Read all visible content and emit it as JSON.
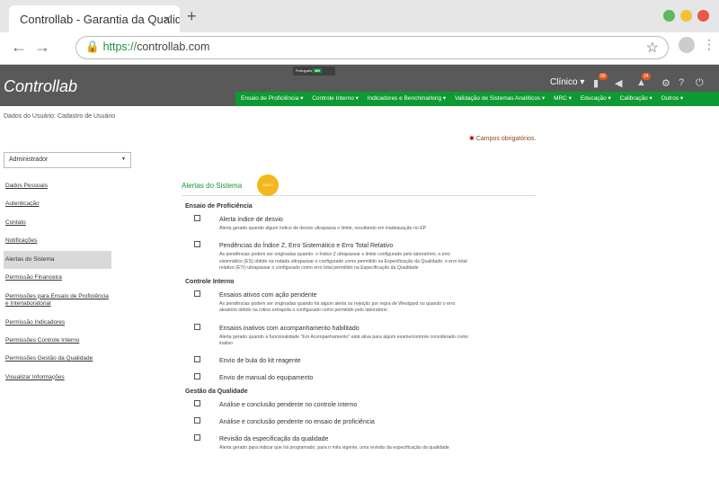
{
  "browser": {
    "tab_title": "Controllab - Garantia da Qualid",
    "tab_close": "×",
    "new_tab": "+",
    "url_proto": "https://",
    "url_host": "controllab.com",
    "dots": [
      "#5cb85c",
      "#f0c23a",
      "#e8564c"
    ]
  },
  "header": {
    "logo": "Controllab",
    "lang_label": "Português",
    "lang_code": "BR",
    "clinico": "Clínico",
    "badge_a": "99",
    "badge_b": "34"
  },
  "menu": [
    "Ensaio de Proficiência ▾",
    "Controle Interno ▾",
    "Indicadores e Benchmarking ▾",
    "Validação de Sistemas Analíticos ▾",
    "MRC ▾",
    "Educação ▾",
    "Calibração ▾",
    "Outros ▾"
  ],
  "breadcrumb": "Dados do Usuário: Cadastro de Usuário",
  "required_note": "Campos obrigatórios.",
  "profile_select": "Administrador",
  "sidebar": [
    "Dados Pessoais",
    "Autenticação",
    "Contato",
    "Notificações",
    "Alertas do Sistema",
    "Permissão Financeira",
    "Permissões para Ensaio de Proficiência e Interlaboratorial",
    "Permissão Indicadores",
    "Permissões Controle Interno",
    "Permissões Gestão da Qualidade",
    "Visualizar Informações"
  ],
  "main": {
    "title": "Alertas do Sistema",
    "novo": "NOVO",
    "groups": [
      {
        "name": "Ensaio de Proficiência",
        "alerts": [
          {
            "t": "Alerta índice de desvio",
            "d": "Alerta gerado quando algum índice de desvio ultrapassa o limite, resultando em inadequação no EP"
          },
          {
            "t": "Pendências do Índice Z, Erro Sistemático e Erro Total Relativo",
            "d": "As pendências podem ser originadas quando: o Índice Z ultrapassar o limite configurado pelo laboratório; o erro sistemático (ES) obtido na rodada ultrapassar o configurado como permitido na Especificação da Qualidade; o erro total relativo (ETr) ultrapassar o configurado como erro total permitido na Especificação da Qualidade"
          }
        ]
      },
      {
        "name": "Controle Interno",
        "alerts": [
          {
            "t": "Ensaios ativos com ação pendente",
            "d": "As pendências podem ser originadas quando há algum alerta ou rejeição por regra de Westgard ou quando o erro aleatório obtido na rotina extrapola o configurado como permitido pelo laboratório"
          },
          {
            "t": "Ensaios inativos com acompanhamento habilitado",
            "d": "Alerta gerado quando a funcionalidade \"Em Acompanhamento\" está ativa para algum exame/controle considerado como inativo"
          },
          {
            "t": "Envio de bula do kit reagente",
            "d": ""
          },
          {
            "t": "Envio de manual do equipamento",
            "d": ""
          }
        ]
      },
      {
        "name": "Gestão da Qualidade",
        "alerts": [
          {
            "t": "Análise e conclusão pendente no controle interno",
            "d": ""
          },
          {
            "t": "Análise e conclusão pendente no ensaio de proficiência",
            "d": ""
          },
          {
            "t": "Revisão da especificação da qualidade",
            "d": "Alerta gerado para indicar que há programado, para o mês vigente, uma revisão da especificação da qualidade"
          }
        ]
      }
    ]
  }
}
